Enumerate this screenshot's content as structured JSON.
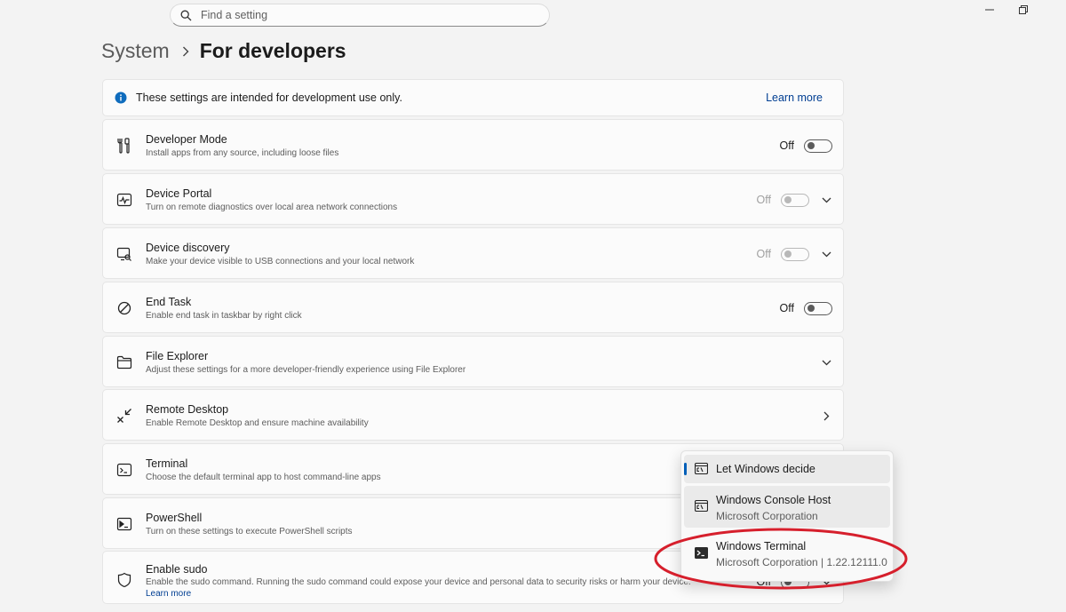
{
  "search": {
    "placeholder": "Find a setting"
  },
  "breadcrumb": {
    "parent": "System",
    "current": "For developers"
  },
  "banner": {
    "text": "These settings are intended for development use only.",
    "link": "Learn more"
  },
  "settings": [
    {
      "title": "Developer Mode",
      "description": "Install apps from any source, including loose files",
      "state": "Off"
    },
    {
      "title": "Device Portal",
      "description": "Turn on remote diagnostics over local area network connections",
      "state": "Off"
    },
    {
      "title": "Device discovery",
      "description": "Make your device visible to USB connections and your local network",
      "state": "Off"
    },
    {
      "title": "End Task",
      "description": "Enable end task in taskbar by right click",
      "state": "Off"
    },
    {
      "title": "File Explorer",
      "description": "Adjust these settings for a more developer-friendly experience using File Explorer"
    },
    {
      "title": "Remote Desktop",
      "description": "Enable Remote Desktop and ensure machine availability"
    },
    {
      "title": "Terminal",
      "description": "Choose the default terminal app to host command-line apps"
    },
    {
      "title": "PowerShell",
      "description": "Turn on these settings to execute PowerShell scripts"
    },
    {
      "title": "Enable sudo",
      "description": "Enable the sudo command. Running the sudo command could expose your device and personal data to security risks or harm your device.",
      "link": "Learn more",
      "state": "Off"
    }
  ],
  "terminal_dropdown": {
    "options": [
      {
        "name": "Let Windows decide"
      },
      {
        "name": "Windows Console Host",
        "publisher": "Microsoft Corporation"
      },
      {
        "name": "Windows Terminal",
        "publisher": "Microsoft Corporation  |  1.22.12111.0"
      }
    ],
    "selected_index": 0
  },
  "colors": {
    "accent": "#005fb8",
    "annotation": "#d61f2c",
    "background": "#f3f3f3",
    "card": "#fbfbfb"
  }
}
